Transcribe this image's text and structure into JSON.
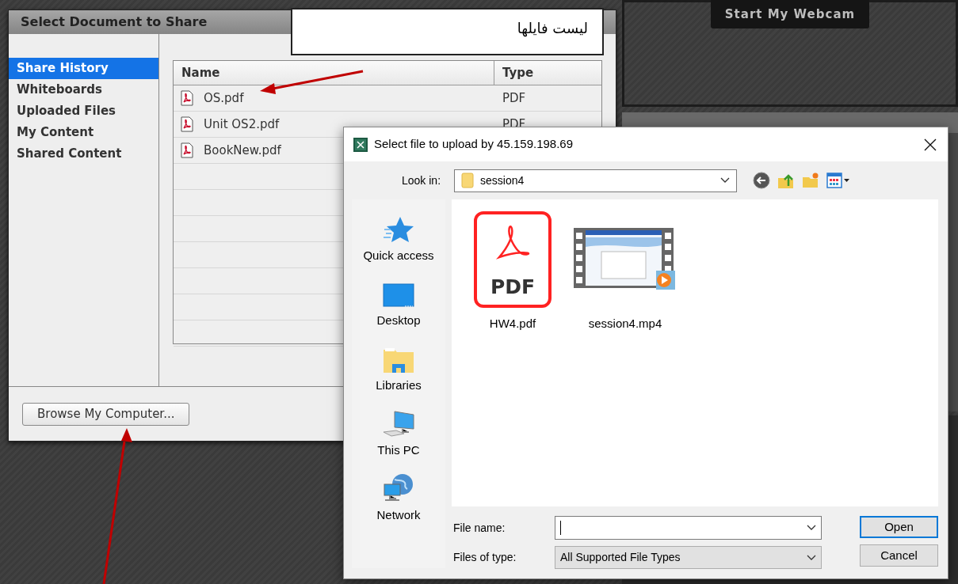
{
  "background_app": {
    "webcam_button": "Start My Webcam"
  },
  "share_dialog": {
    "title": "Select Document to Share",
    "sidebar": [
      {
        "label": "Share History",
        "selected": true
      },
      {
        "label": "Whiteboards",
        "selected": false
      },
      {
        "label": "Uploaded Files",
        "selected": false
      },
      {
        "label": "My Content",
        "selected": false
      },
      {
        "label": "Shared Content",
        "selected": false
      }
    ],
    "table": {
      "columns": [
        "Name",
        "Type"
      ],
      "rows": [
        {
          "name": "OS.pdf",
          "type": "PDF"
        },
        {
          "name": "Unit OS2.pdf",
          "type": "PDF"
        },
        {
          "name": "BookNew.pdf"
        }
      ]
    },
    "browse_button": "Browse My Computer..."
  },
  "callout": {
    "text": "ليست فايلها"
  },
  "upload_dialog": {
    "title": "Select file to upload by 45.159.198.69",
    "look_in": {
      "label": "Look in:",
      "value": "session4"
    },
    "places": [
      {
        "label": "Quick access",
        "kind": "quick-access"
      },
      {
        "label": "Desktop",
        "kind": "desktop"
      },
      {
        "label": "Libraries",
        "kind": "libraries"
      },
      {
        "label": "This PC",
        "kind": "pc"
      },
      {
        "label": "Network",
        "kind": "network"
      }
    ],
    "files": [
      {
        "name": "HW4.pdf",
        "kind": "pdf",
        "icon_label": "PDF"
      },
      {
        "name": "session4.mp4",
        "kind": "video"
      }
    ],
    "file_name": {
      "label": "File name:"
    },
    "files_of_type": {
      "label": "Files of type:",
      "value": "All Supported File Types"
    },
    "buttons": [
      {
        "label": "Open",
        "default": true
      },
      {
        "label": "Cancel",
        "default": false
      }
    ]
  }
}
